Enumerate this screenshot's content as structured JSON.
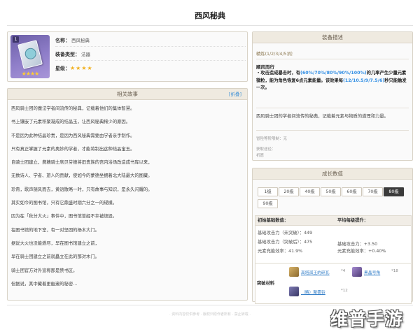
{
  "page": {
    "title": "西风秘典"
  },
  "weapon": {
    "rank_badge": "1",
    "name_label": "名称：",
    "name_value": "西风秘典",
    "type_label": "装备类型：",
    "type_value": "法器",
    "rarity_label": "星级：",
    "rarity_stars": "★★★★",
    "icon_stars": "★★★★"
  },
  "lore": {
    "header": "相关故事",
    "fold_label": "[折叠]",
    "lines": [
      "西风骑士团的魔法学者间流传的秘典，记载着他们的集体智慧。",
      "书上镶嵌了元素积聚凝成的结晶玉，让西风秘典稀少的原因。",
      "不是因为此种结晶珍贵，是因为西风秘典需要由学者亲手制作。",
      "只有真正掌握了元素的奥妙的学者，才能将制出这种结晶宝玉。",
      "自骑士团建立，费穗骑士席贝芬德将旧贵族的宫内浴场改造成书库以来，",
      "无数诗人、学者、旅人的贡献，使如今的蒙德坐拥着北大陆最大的图藏。",
      "珍貴，歌声随风而去，黄语散略一时，只有故事与知识，是永久闪耀的。",
      "其实如今的图书馆，只有它鼎盛时期六分之一的规模。",
      "因为在「秋分大火」事件中，图书馆曾经不幸被烧毁。",
      "在图书馆的地下室，有一对坚固的杨木大门。",
      "据说大火也没能燃尽，早在图书馆建立之前，",
      "早在骑士团建立之前就矗立在此的那对木门。",
      "骑士团官方对外宣称那是禁书区。",
      "但据说，其中藏着更幽邃的秘密…"
    ]
  },
  "description": {
    "header": "装备描述",
    "refine": "精炼(1/2/3/4/5)阶",
    "skill_title": "顺风而行",
    "skill_prefix": "・攻击造成暴击时，有",
    "skill_chance": "(60%/70%/80%/90%/100%)",
    "skill_mid": "的几率产生少量元素微粒，能为角色恢复6点元素能量。该效果每",
    "skill_cd": "(12/10.5/9/7.5/6)",
    "skill_suffix": "秒只能触发一次。",
    "flavor": "西风骑士团的学者间流传的秘典，记载着元素与物质的道理和力量。",
    "meta_limit": "冒险等阶限制：无",
    "meta_source_label": "获取途径：",
    "meta_source_value": "祈愿"
  },
  "stats": {
    "header": "成长数值",
    "levels": [
      "1级",
      "20级",
      "40级",
      "50级",
      "60级",
      "70级",
      "80级",
      "90级"
    ],
    "active_level": "80级",
    "base_header": "初始基础数值：",
    "avg_header": "平均每级提升：",
    "base_atk_pre": "基础攻击力（未突破）：449",
    "base_atk_post": "基础攻击力（突破后）：475",
    "base_er": "元素充能效率：41.9%",
    "avg_atk_pre": "",
    "avg_atk_post": "基础攻击力：+3.50",
    "avg_er": "元素充能效率：+0.40%",
    "materials_label": "突破材料",
    "materials": [
      {
        "name": "高塔孤王的碎瓦",
        "count": "*4"
      },
      {
        "name": "黑晶号角",
        "count": "*18"
      },
      {
        "name": "（略）聚雾铃",
        "count": "*12"
      }
    ]
  },
  "footer": {
    "note": "· 资料内容仅供参考 · 版权归原作者所有 · 禁止转载 ·"
  },
  "watermark": {
    "text": "维普手游网"
  }
}
